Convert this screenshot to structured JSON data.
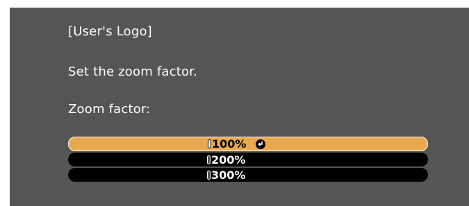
{
  "dialog": {
    "title": "[User's Logo]",
    "instruction": "Set the zoom factor.",
    "field_label": "Zoom factor:"
  },
  "zoom_options": [
    {
      "label": "100%",
      "selected": true
    },
    {
      "label": "200%",
      "selected": false
    },
    {
      "label": "300%",
      "selected": false
    }
  ],
  "icons": {
    "enter": "enter-icon"
  },
  "colors": {
    "background": "#555555",
    "selected": "#e8a84e",
    "option_bg": "#000000"
  }
}
